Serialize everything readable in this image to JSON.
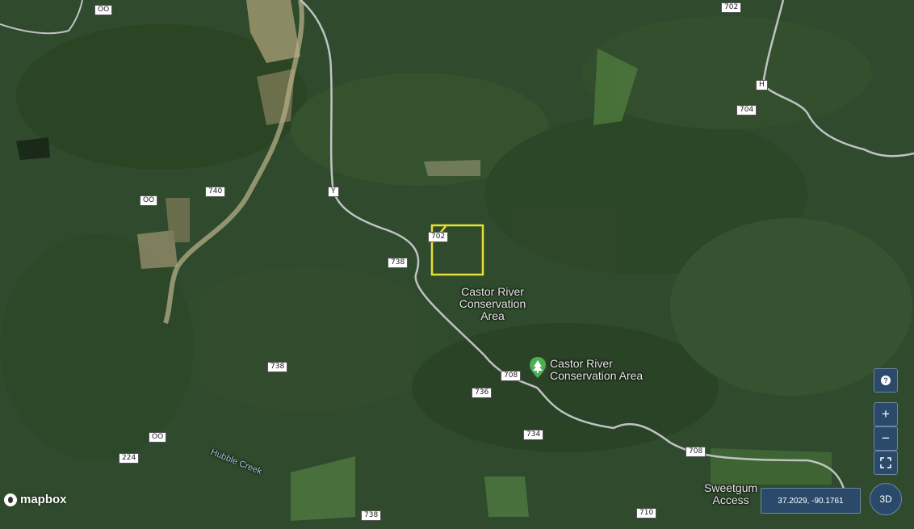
{
  "map": {
    "shields": [
      {
        "id": "oo-top",
        "text": "OO"
      },
      {
        "id": "702-top",
        "text": "702"
      },
      {
        "id": "h",
        "text": "H"
      },
      {
        "id": "704",
        "text": "704"
      },
      {
        "id": "y",
        "text": "Y"
      },
      {
        "id": "740",
        "text": "740"
      },
      {
        "id": "oo-mid",
        "text": "OO"
      },
      {
        "id": "702-box",
        "text": "702"
      },
      {
        "id": "738-a",
        "text": "738"
      },
      {
        "id": "738-b",
        "text": "738"
      },
      {
        "id": "708-a",
        "text": "708"
      },
      {
        "id": "736",
        "text": "736"
      },
      {
        "id": "oo-low",
        "text": "OO"
      },
      {
        "id": "224",
        "text": "224"
      },
      {
        "id": "734",
        "text": "734"
      },
      {
        "id": "708-b",
        "text": "708"
      },
      {
        "id": "738-c",
        "text": "738"
      },
      {
        "id": "710",
        "text": "710"
      }
    ],
    "labels": {
      "area_line1": "Castor River",
      "area_line2": "Conservation",
      "area_line3": "Area",
      "poi_line1": "Castor River",
      "poi_line2": "Conservation Area",
      "creek": "Hubble Creek",
      "sweetgum_line1": "Sweetgum",
      "sweetgum_line2": "Access"
    },
    "poi_icon": "tree-icon",
    "selection_color": "#e6e033"
  },
  "controls": {
    "help": "?",
    "zoom_in": "+",
    "zoom_out": "−",
    "fullscreen": "⛶",
    "coordinates": "37.2029, -90.1761",
    "three_d": "3D"
  },
  "branding": {
    "logo_text": "mapbox"
  }
}
